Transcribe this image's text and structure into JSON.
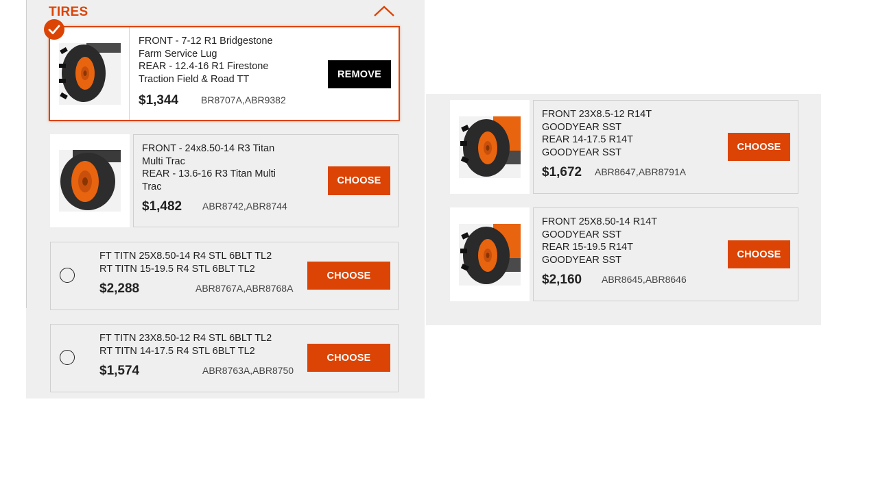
{
  "section": {
    "title": "TIRES"
  },
  "colors": {
    "accent": "#dc4405",
    "panel": "#efefef",
    "remove_button": "#000000"
  },
  "options": [
    {
      "selected": true,
      "lines": [
        "FRONT - 7-12 R1 Bridgestone",
        "Farm Service Lug",
        "REAR - 12.4-16 R1 Firestone",
        "Traction Field & Road TT"
      ],
      "price": "$1,344",
      "sku": "BR8707A,ABR9382",
      "button": "REMOVE",
      "image": "agricultural-lug-tire-icon"
    },
    {
      "selected": false,
      "lines": [
        "FRONT - 24x8.50-14 R3 Titan",
        "Multi Trac",
        "REAR - 13.6-16 R3 Titan Multi",
        "Trac"
      ],
      "price": "$1,482",
      "sku": "ABR8742,ABR8744",
      "button": "CHOOSE",
      "image": "turf-tire-icon"
    },
    {
      "selected": false,
      "lines": [
        "FT TITN 25X8.50-14 R4 STL 6BLT TL2",
        "RT TITN 15-19.5 R4 STL 6BLT TL2"
      ],
      "price": "$2,288",
      "sku": "ABR8767A,ABR8768A",
      "button": "CHOOSE"
    },
    {
      "selected": false,
      "lines": [
        "FT TITN 23X8.50-12 R4 STL 6BLT TL2",
        "RT TITN 14-17.5 R4 STL 6BLT TL2"
      ],
      "price": "$1,574",
      "sku": "ABR8763A,ABR8750",
      "button": "CHOOSE"
    },
    {
      "selected": false,
      "lines": [
        "FRONT 23X8.5-12 R14T",
        "GOODYEAR SST",
        "REAR 14-17.5 R14T",
        "GOODYEAR SST"
      ],
      "price": "$1,672",
      "sku": "ABR8647,ABR8791A",
      "button": "CHOOSE",
      "image": "industrial-tire-icon"
    },
    {
      "selected": false,
      "lines": [
        "FRONT 25X8.50-14 R14T",
        "GOODYEAR SST",
        "REAR 15-19.5 R14T",
        "GOODYEAR SST"
      ],
      "price": "$2,160",
      "sku": "ABR8645,ABR8646",
      "button": "CHOOSE",
      "image": "industrial-tire-icon"
    }
  ]
}
